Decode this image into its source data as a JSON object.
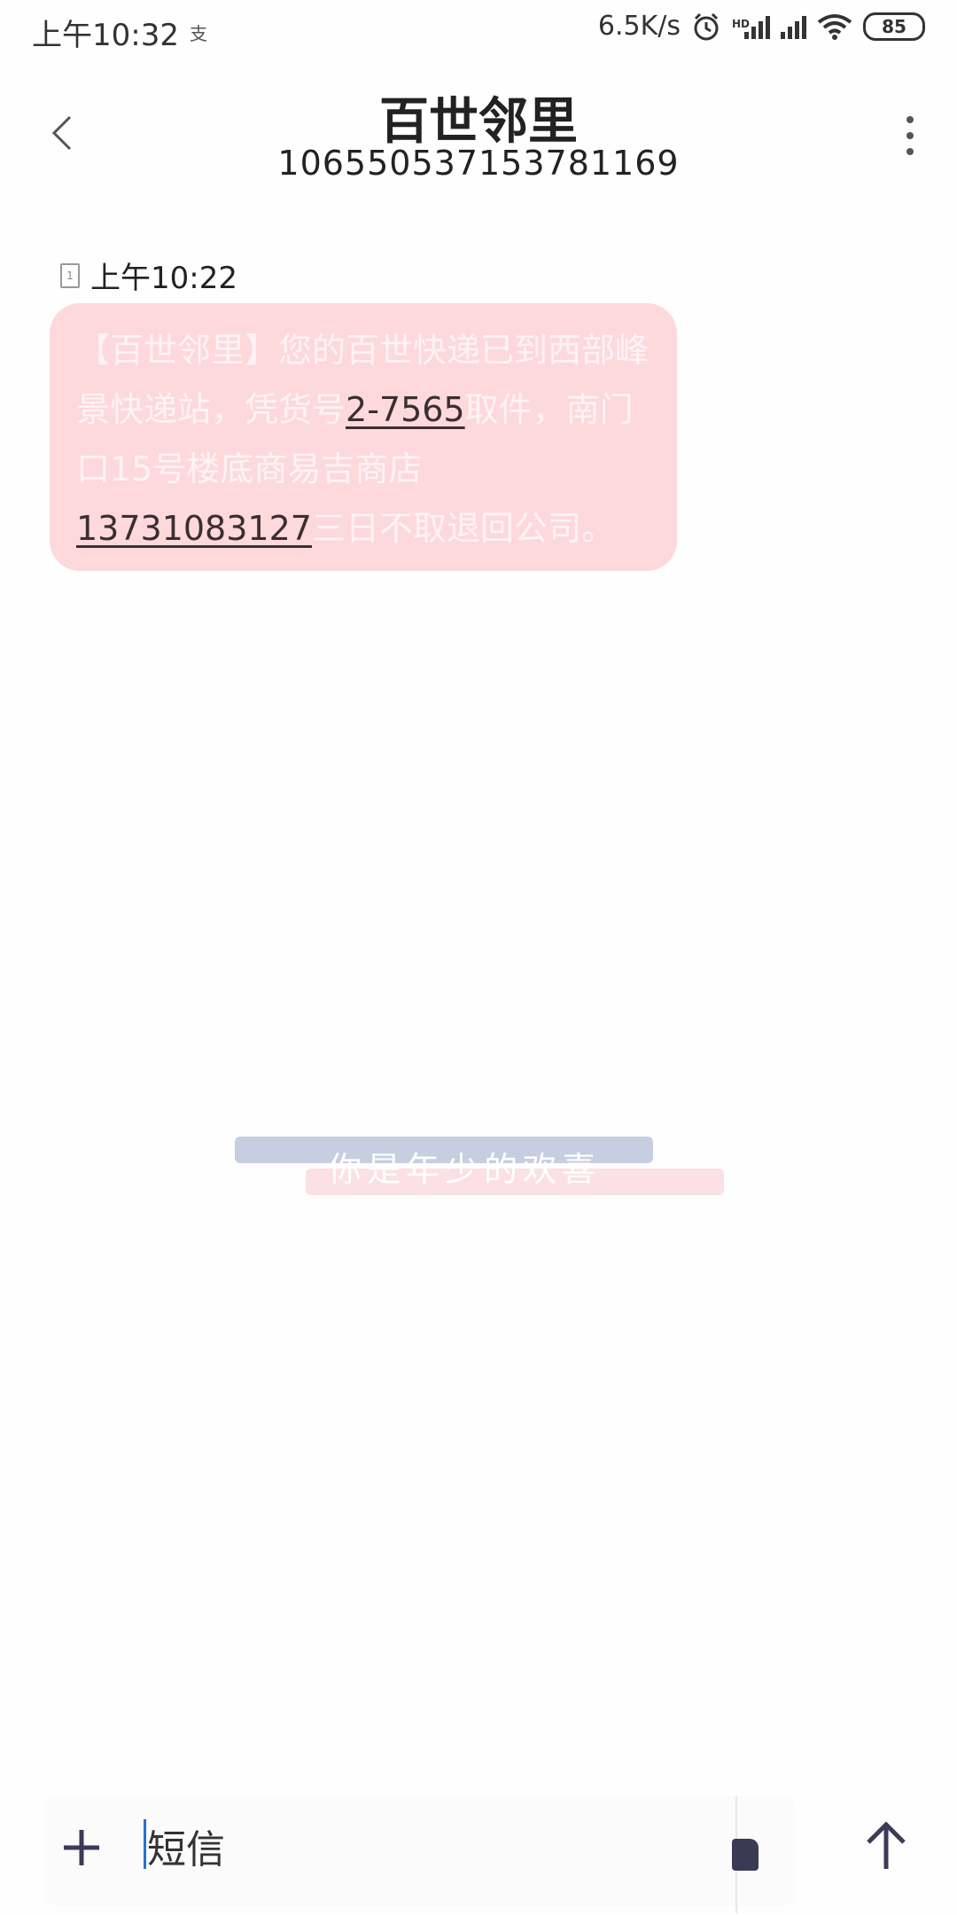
{
  "status_bar": {
    "time": "上午10:32",
    "notification": "支",
    "speed": "6.5K/s",
    "hd": "HD",
    "battery": "85"
  },
  "header": {
    "title": "百世邻里",
    "number": "10655053715378116​9"
  },
  "message": {
    "time": "上午10:22",
    "sim": "1",
    "segments": [
      {
        "text": "【百世邻里】您的百世快递已到西部峰景快递站，凭货号",
        "link": false
      },
      {
        "text": "2-7565",
        "link": true
      },
      {
        "text": "取件，南门口15号楼底商易吉商店",
        "link": false
      },
      {
        "text": "13731083127",
        "link": true
      },
      {
        "text": "三日不取退回公司。",
        "link": false
      }
    ]
  },
  "wallpaper": {
    "text": "你是年少的欢喜",
    "colors": {
      "blue": "#c7cedf",
      "pink": "#fbe0e5"
    }
  },
  "composer": {
    "placeholder": "短信",
    "icons": [
      "plus-icon",
      "sticker-icon",
      "send-arrow-icon"
    ]
  },
  "colors": {
    "bubble": "#fdd9dc",
    "link_text": "#3a2f30"
  }
}
